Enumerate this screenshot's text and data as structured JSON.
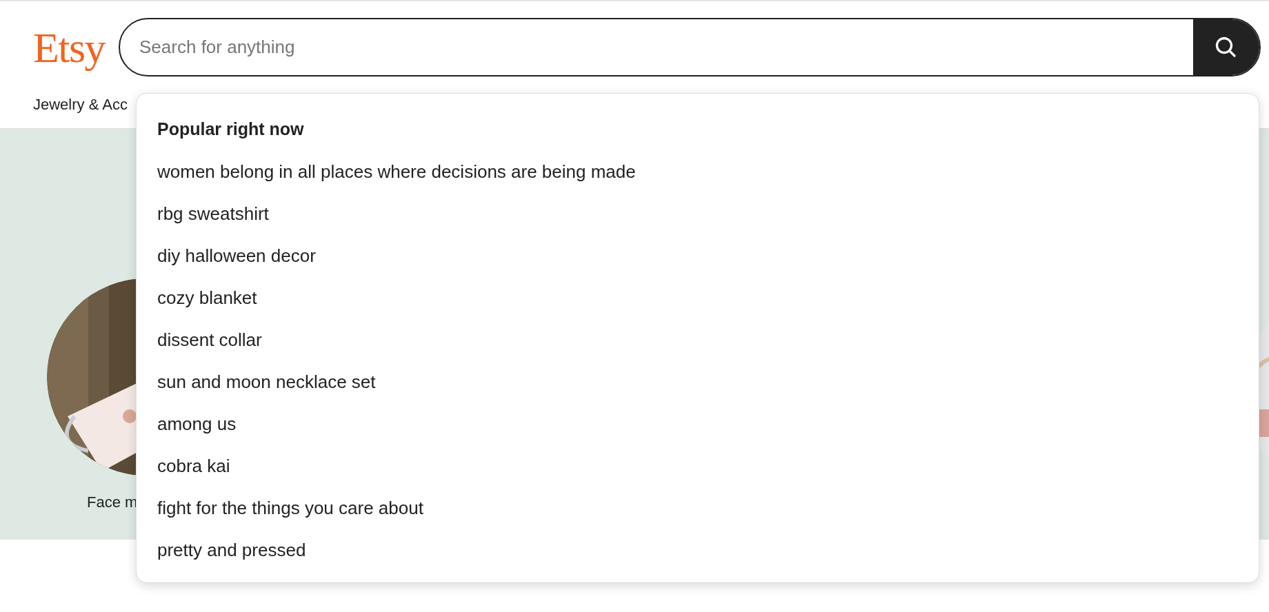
{
  "header": {
    "logo": "Etsy",
    "search": {
      "placeholder": "Search for anything"
    }
  },
  "nav": {
    "items": [
      "Jewelry & Acc"
    ]
  },
  "featured": [
    {
      "kind": "picture",
      "label": "Face m"
    }
  ],
  "suggestions": {
    "title": "Popular right now",
    "items": [
      "women belong in all places where decisions are being made",
      "rbg sweatshirt",
      "diy halloween decor",
      "cozy blanket",
      "dissent collar",
      "sun and moon necklace set",
      "among us",
      "cobra kai",
      "fight for the things you care about",
      "pretty and pressed"
    ]
  }
}
